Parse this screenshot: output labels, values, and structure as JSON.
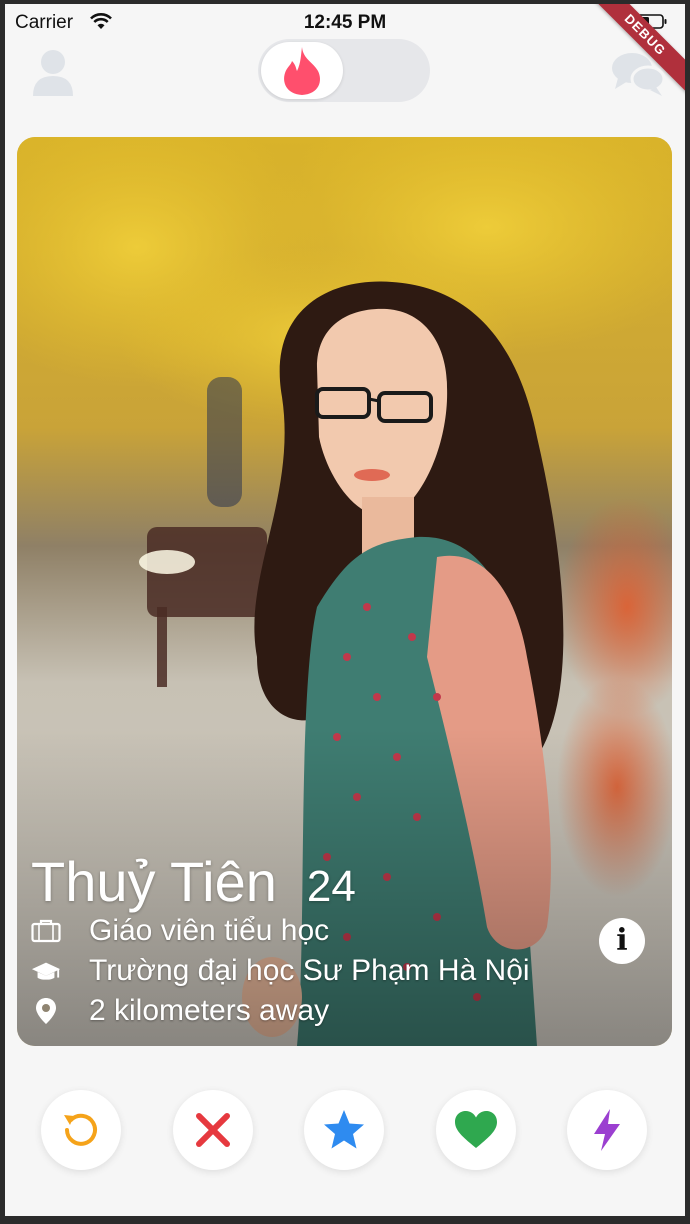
{
  "status_bar": {
    "carrier": "Carrier",
    "time": "12:45 PM",
    "debug_label": "DEBUG"
  },
  "profile": {
    "name": "Thuỷ Tiên",
    "age": "24",
    "job": "Giáo viên tiểu học",
    "school": "Trường đại học Sư Phạm Hà Nội",
    "distance": "2 kilometers away"
  },
  "info_button": {
    "symbol": "i"
  },
  "actions": [
    {
      "name": "rewind",
      "icon": "rewind-icon",
      "color": "#f5a31a"
    },
    {
      "name": "nope",
      "icon": "close-icon",
      "color": "#e6393f"
    },
    {
      "name": "super-like",
      "icon": "star-icon",
      "color": "#2e8bf0"
    },
    {
      "name": "like",
      "icon": "heart-icon",
      "color": "#2fa84f"
    },
    {
      "name": "boost",
      "icon": "lightning-icon",
      "color": "#9b3fd0"
    }
  ],
  "colors": {
    "brand": "#ff4f6d",
    "toggle_track": "#e6e7ea",
    "inactive_icon": "#dfe3e8"
  }
}
